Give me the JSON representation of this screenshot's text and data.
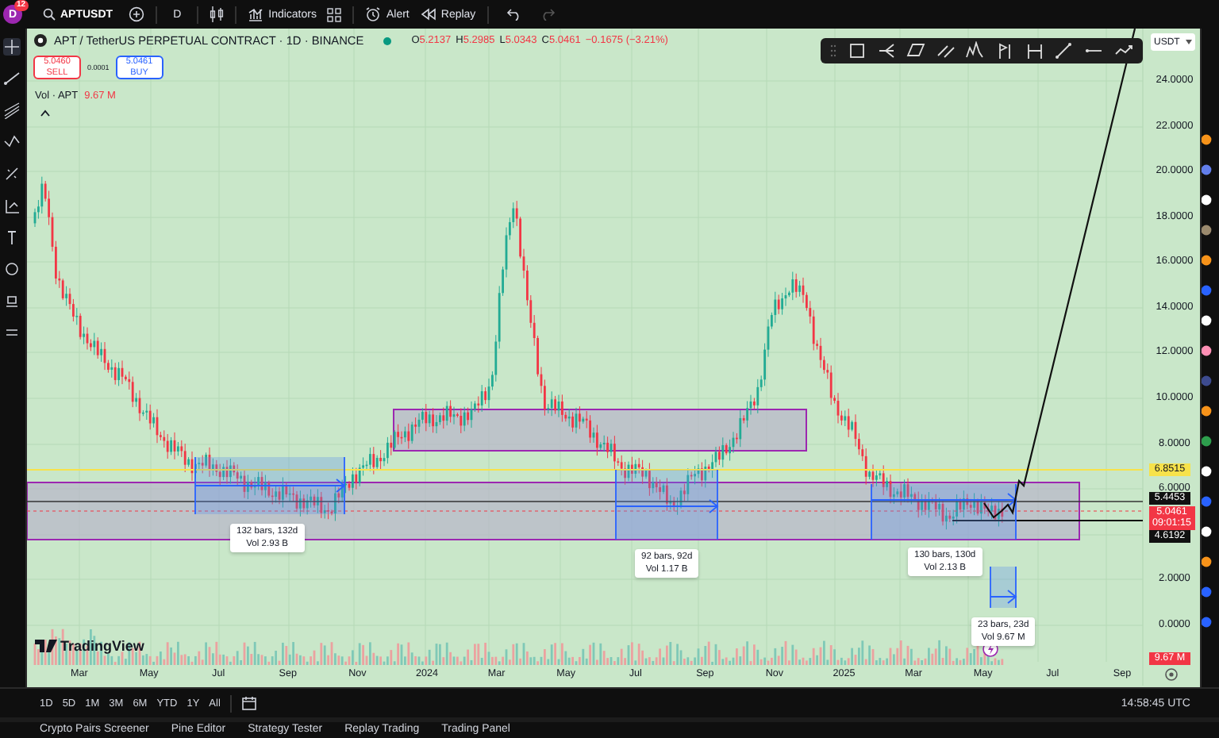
{
  "top_bar": {
    "avatar": "D",
    "notification_count": "12",
    "symbol": "APTUSDT",
    "interval": "D",
    "buttons": [
      {
        "kind": "indicators",
        "label": "Indicators"
      },
      {
        "kind": "alert",
        "label": "Alert"
      },
      {
        "kind": "replay",
        "label": "Replay"
      }
    ]
  },
  "legend": {
    "title": "APT / TetherUS PERPETUAL CONTRACT · 1D · BINANCE",
    "ohlc": [
      {
        "key": "O",
        "value": "5.2137"
      },
      {
        "key": "H",
        "value": "5.2985"
      },
      {
        "key": "L",
        "value": "5.0343"
      },
      {
        "key": "C",
        "value": "5.0461"
      }
    ],
    "change": "−0.1675 (−3.21%)",
    "sell": {
      "price": "5.0460",
      "label": "SELL"
    },
    "spread": "0.0001",
    "buy": {
      "price": "5.0461",
      "label": "BUY"
    },
    "volume": {
      "label": "Vol · APT",
      "value": "9.67 M"
    }
  },
  "currency": "USDT",
  "price_axis": {
    "ticks": [
      "24.0000",
      "22.0000",
      "20.0000",
      "18.0000",
      "16.0000",
      "14.0000",
      "12.0000",
      "10.0000",
      "8.0000",
      "6.0000",
      "2.0000",
      "0.0000"
    ],
    "markers": [
      {
        "kind": "highlight",
        "value": "6.8515"
      },
      {
        "kind": "line",
        "value": "5.4453"
      },
      {
        "kind": "last",
        "value": "5.0461",
        "countdown": "09:01:15"
      },
      {
        "kind": "line",
        "value": "4.6192"
      },
      {
        "kind": "volume",
        "value": "9.67 M"
      }
    ]
  },
  "time_axis": {
    "labels": [
      "Mar",
      "May",
      "Jul",
      "Sep",
      "Nov",
      "2024",
      "Mar",
      "May",
      "Jul",
      "Sep",
      "Nov",
      "2025",
      "Mar",
      "May",
      "Jul",
      "Sep"
    ]
  },
  "measurements": [
    {
      "bars": "132 bars, 132d",
      "volume": "Vol 2.93 B"
    },
    {
      "bars": "92 bars, 92d",
      "volume": "Vol 1.17 B"
    },
    {
      "bars": "130 bars, 130d",
      "volume": "Vol 2.13 B"
    },
    {
      "bars": "23 bars, 23d",
      "volume": "Vol 9.67 M"
    }
  ],
  "watermark_logo": "TradingView",
  "periods": [
    {
      "label": "1D"
    },
    {
      "label": "5D"
    },
    {
      "label": "1M"
    },
    {
      "label": "3M"
    },
    {
      "label": "6M"
    },
    {
      "label": "YTD"
    },
    {
      "label": "1Y"
    },
    {
      "label": "All"
    }
  ],
  "clock": "14:58:45 UTC",
  "bottom_tabs": [
    "Crypto Pairs Screener",
    "Pine Editor",
    "Strategy Tester",
    "Replay Trading",
    "Trading Panel"
  ]
}
